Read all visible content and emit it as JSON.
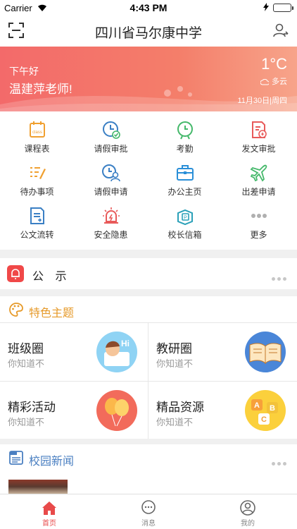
{
  "status_bar": {
    "carrier": "Carrier",
    "time": "4:43 PM",
    "battery_level": 1.0
  },
  "nav": {
    "title": "四川省马尔康中学"
  },
  "banner": {
    "greeting": "下午好",
    "name": "温建萍老师!",
    "temperature": "1°C",
    "weather": "多云",
    "date": "11月30日|周四"
  },
  "grid": [
    {
      "label": "课程表",
      "icon": "class-schedule-icon",
      "color": "#f0a030"
    },
    {
      "label": "请假审批",
      "icon": "leave-approve-icon",
      "color": "#3a7fc4"
    },
    {
      "label": "考勤",
      "icon": "clock-icon",
      "color": "#44b86a"
    },
    {
      "label": "发文审批",
      "icon": "document-approve-icon",
      "color": "#e85a5a"
    },
    {
      "label": "待办事项",
      "icon": "todo-list-icon",
      "color": "#f0a030"
    },
    {
      "label": "请假申请",
      "icon": "leave-apply-icon",
      "color": "#3a7fc4"
    },
    {
      "label": "办公主页",
      "icon": "briefcase-icon",
      "color": "#2a8fd8"
    },
    {
      "label": "出差申请",
      "icon": "airplane-icon",
      "color": "#44b86a"
    },
    {
      "label": "公文流转",
      "icon": "document-flow-icon",
      "color": "#3a7fc4"
    },
    {
      "label": "安全隐患",
      "icon": "alarm-icon",
      "color": "#e85a5a"
    },
    {
      "label": "校长信箱",
      "icon": "mailbox-icon",
      "color": "#2aa0b8"
    },
    {
      "label": "更多",
      "icon": "more-dots-icon",
      "color": "#b0b0b0"
    }
  ],
  "notice": {
    "label": "公 示"
  },
  "featured": {
    "title": "特色主题",
    "cards": [
      {
        "title": "班级圈",
        "subtitle": "你知道不",
        "icon": "class-circle-icon"
      },
      {
        "title": "教研圈",
        "subtitle": "你知道不",
        "icon": "book-icon"
      },
      {
        "title": "精彩活动",
        "subtitle": "你知道不",
        "icon": "balloons-icon"
      },
      {
        "title": "精品资源",
        "subtitle": "你知道不",
        "icon": "abc-blocks-icon"
      }
    ]
  },
  "news": {
    "title": "校园新闻"
  },
  "tabbar": [
    {
      "label": "首页",
      "icon": "home-icon",
      "active": true
    },
    {
      "label": "消息",
      "icon": "message-icon",
      "active": false
    },
    {
      "label": "我的",
      "icon": "profile-icon",
      "active": false
    }
  ],
  "colors": {
    "accent": "#f36a6a",
    "featured_title": "#e69a2a",
    "news_title": "#4a7fc1",
    "active_tab": "#e84a4a"
  }
}
